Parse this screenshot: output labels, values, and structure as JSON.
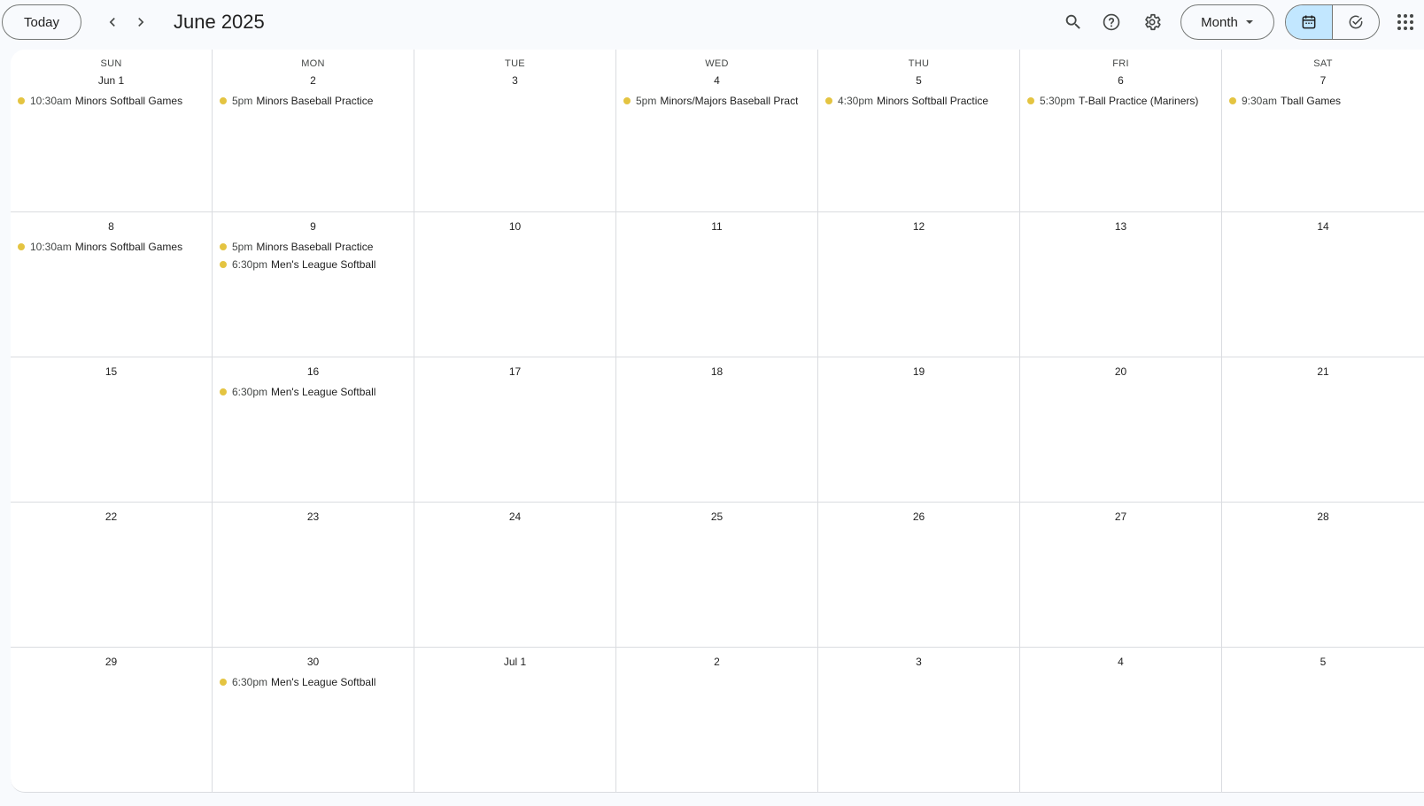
{
  "header": {
    "today_label": "Today",
    "title": "June 2025",
    "view_label": "Month"
  },
  "colors": {
    "event_dot": "#e4c441",
    "active_toggle": "#c2e7ff"
  },
  "weekdays": [
    "SUN",
    "MON",
    "TUE",
    "WED",
    "THU",
    "FRI",
    "SAT"
  ],
  "weeks": [
    {
      "days": [
        {
          "label": "Jun 1",
          "events": [
            {
              "time": "10:30am",
              "title": "Minors Softball Games"
            }
          ]
        },
        {
          "label": "2",
          "events": [
            {
              "time": "5pm",
              "title": "Minors Baseball Practice"
            }
          ]
        },
        {
          "label": "3",
          "events": []
        },
        {
          "label": "4",
          "events": [
            {
              "time": "5pm",
              "title": "Minors/Majors Baseball Pract"
            }
          ]
        },
        {
          "label": "5",
          "events": [
            {
              "time": "4:30pm",
              "title": "Minors Softball Practice"
            }
          ]
        },
        {
          "label": "6",
          "events": [
            {
              "time": "5:30pm",
              "title": "T-Ball Practice (Mariners)"
            }
          ]
        },
        {
          "label": "7",
          "events": [
            {
              "time": "9:30am",
              "title": "Tball Games"
            }
          ]
        }
      ]
    },
    {
      "days": [
        {
          "label": "8",
          "events": [
            {
              "time": "10:30am",
              "title": "Minors Softball Games"
            }
          ]
        },
        {
          "label": "9",
          "events": [
            {
              "time": "5pm",
              "title": "Minors Baseball Practice"
            },
            {
              "time": "6:30pm",
              "title": "Men's League Softball"
            }
          ]
        },
        {
          "label": "10",
          "events": []
        },
        {
          "label": "11",
          "events": []
        },
        {
          "label": "12",
          "events": []
        },
        {
          "label": "13",
          "events": []
        },
        {
          "label": "14",
          "events": []
        }
      ]
    },
    {
      "days": [
        {
          "label": "15",
          "events": []
        },
        {
          "label": "16",
          "events": [
            {
              "time": "6:30pm",
              "title": "Men's League Softball"
            }
          ]
        },
        {
          "label": "17",
          "events": []
        },
        {
          "label": "18",
          "events": []
        },
        {
          "label": "19",
          "events": []
        },
        {
          "label": "20",
          "events": []
        },
        {
          "label": "21",
          "events": []
        }
      ]
    },
    {
      "days": [
        {
          "label": "22",
          "events": []
        },
        {
          "label": "23",
          "events": []
        },
        {
          "label": "24",
          "events": []
        },
        {
          "label": "25",
          "events": []
        },
        {
          "label": "26",
          "events": []
        },
        {
          "label": "27",
          "events": []
        },
        {
          "label": "28",
          "events": []
        }
      ]
    },
    {
      "days": [
        {
          "label": "29",
          "events": []
        },
        {
          "label": "30",
          "events": [
            {
              "time": "6:30pm",
              "title": "Men's League Softball"
            }
          ]
        },
        {
          "label": "Jul 1",
          "events": []
        },
        {
          "label": "2",
          "events": []
        },
        {
          "label": "3",
          "events": []
        },
        {
          "label": "4",
          "events": []
        },
        {
          "label": "5",
          "events": []
        }
      ]
    }
  ]
}
